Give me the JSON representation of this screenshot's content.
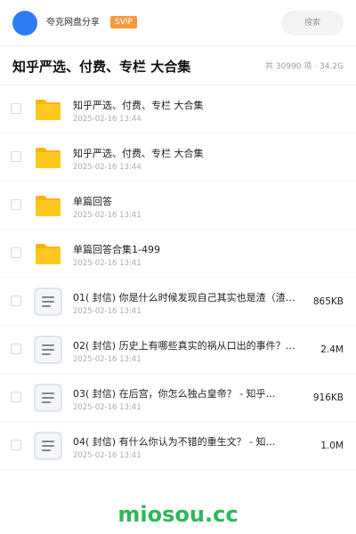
{
  "header": {
    "username": "夸克网盘分享",
    "badge": "SVIP",
    "search_placeholder": "搜索",
    "avatar_color": "#2f7df6",
    "badge_color": "#f29b3b"
  },
  "folder": {
    "title": "知乎严选、付费、专栏 大合集",
    "meta": "共 30990 项 · 34.2G"
  },
  "items": [
    {
      "type": "folder",
      "icon": "folder-icon",
      "name": "知乎严选、付费、专栏 大合集",
      "date": "2025-02-16 13:44",
      "size": ""
    },
    {
      "type": "folder",
      "icon": "folder-icon",
      "name": "知乎严选、付费、专栏 大合集",
      "date": "2025-02-16 13:44",
      "size": ""
    },
    {
      "type": "folder",
      "icon": "folder-icon",
      "name": "单篇回答",
      "date": "2025-02-16 13:41",
      "size": ""
    },
    {
      "type": "folder",
      "icon": "folder-icon",
      "name": "单篇回答合集1-499",
      "date": "2025-02-16 13:41",
      "size": ""
    },
    {
      "type": "file",
      "icon": "document-icon",
      "name": "01( 封信) 你是什么时候发现自己其实也是渣（渣…",
      "date": "2025-02-16 13:41",
      "size": "865KB"
    },
    {
      "type": "file",
      "icon": "document-icon",
      "name": "02( 封信) 历史上有哪些真实的祸从口出的事件？…",
      "date": "2025-02-16 13:41",
      "size": "2.4M"
    },
    {
      "type": "file",
      "icon": "document-icon",
      "name": "03( 封信) 在后宫，你怎么独占皇帝？ - 知乎…",
      "date": "2025-02-16 13:41",
      "size": "916KB"
    },
    {
      "type": "file",
      "icon": "document-icon",
      "name": "04( 封信) 有什么你认为不错的重生文？ - 知…",
      "date": "2025-02-16 13:41",
      "size": "1.0M"
    }
  ],
  "watermark": "miosou.cc",
  "watermark_color": "#2db85a"
}
